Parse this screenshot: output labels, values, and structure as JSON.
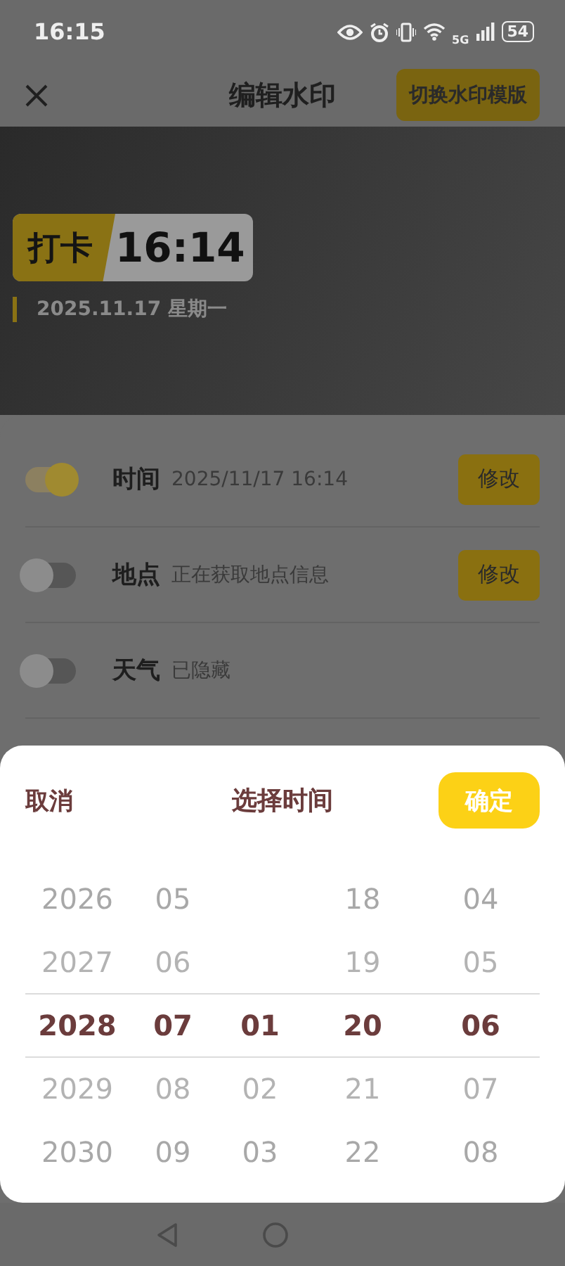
{
  "status_bar": {
    "time": "16:15",
    "network": "5G",
    "battery": "54"
  },
  "header": {
    "title": "编辑水印",
    "action": "切换水印模版"
  },
  "watermark": {
    "label": "打卡",
    "time": "16:14",
    "date": "2025.11.17 星期一"
  },
  "settings": [
    {
      "label": "时间",
      "value": "2025/11/17 16:14",
      "on": true,
      "button": "修改"
    },
    {
      "label": "地点",
      "value": "正在获取地点信息",
      "on": false,
      "button": "修改"
    },
    {
      "label": "天气",
      "value": "已隐藏",
      "on": false
    }
  ],
  "picker": {
    "cancel": "取消",
    "title": "选择时间",
    "confirm": "确定",
    "columns": [
      {
        "items": [
          {
            "text": "2026",
            "selected": false
          },
          {
            "text": "2027",
            "selected": false
          },
          {
            "text": "2028",
            "selected": true
          },
          {
            "text": "2029",
            "selected": false
          },
          {
            "text": "2030",
            "selected": false
          }
        ]
      },
      {
        "items": [
          {
            "text": "05",
            "selected": false
          },
          {
            "text": "06",
            "selected": false
          },
          {
            "text": "07",
            "selected": true
          },
          {
            "text": "08",
            "selected": false
          },
          {
            "text": "09",
            "selected": false
          }
        ]
      },
      {
        "items": [
          {
            "text": "01",
            "selected": true
          },
          {
            "text": "02",
            "selected": false
          },
          {
            "text": "03",
            "selected": false
          }
        ]
      },
      {
        "items": [
          {
            "text": "18",
            "selected": false
          },
          {
            "text": "19",
            "selected": false
          },
          {
            "text": "20",
            "selected": true
          },
          {
            "text": "21",
            "selected": false
          },
          {
            "text": "22",
            "selected": false
          }
        ]
      },
      {
        "items": [
          {
            "text": "04",
            "selected": false
          },
          {
            "text": "05",
            "selected": false
          },
          {
            "text": "06",
            "selected": true
          },
          {
            "text": "07",
            "selected": false
          },
          {
            "text": "08",
            "selected": false
          }
        ]
      }
    ]
  }
}
